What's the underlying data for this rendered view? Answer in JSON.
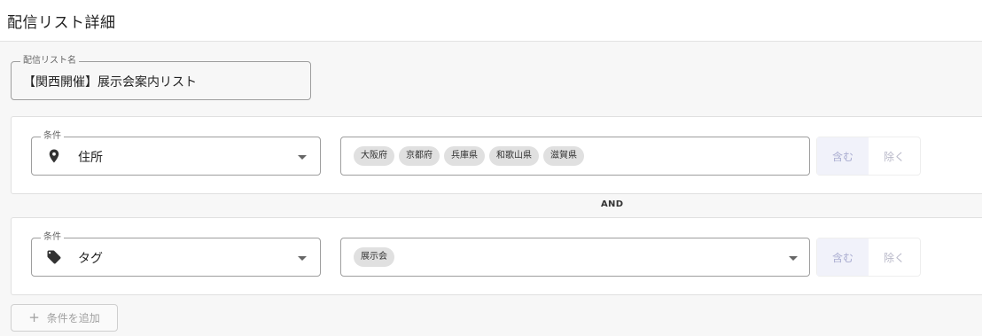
{
  "header": {
    "title": "配信リスト詳細"
  },
  "list_name": {
    "legend": "配信リスト名",
    "value": "【関西開催】展示会案内リスト"
  },
  "conditions": [
    {
      "legend": "条件",
      "type_label": "住所",
      "type_icon": "location-pin-icon",
      "values": [
        "大阪府",
        "京都府",
        "兵庫県",
        "和歌山県",
        "滋賀県"
      ],
      "include_label": "含む",
      "exclude_label": "除く",
      "selected_mode": "include"
    },
    {
      "legend": "条件",
      "type_label": "タグ",
      "type_icon": "tag-icon",
      "values": [
        "展示会"
      ],
      "include_label": "含む",
      "exclude_label": "除く",
      "selected_mode": "include"
    }
  ],
  "operator": "AND",
  "add_condition": {
    "label": "条件を追加",
    "icon": "plus-icon"
  }
}
